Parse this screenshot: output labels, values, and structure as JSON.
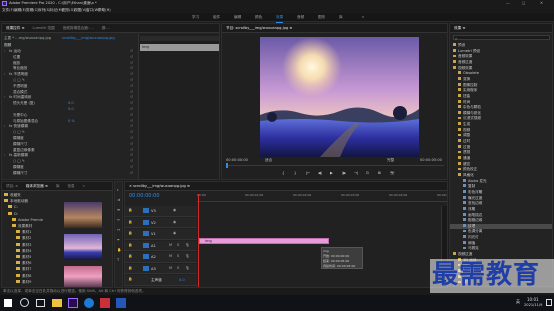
{
  "window": {
    "title": "Adobe Premiere Pro 2020 - C:\\用户\\Ethan\\桌面\\a *",
    "min_glyph": "—",
    "max_glyph": "□",
    "close_glyph": "✕"
  },
  "menubar": {
    "items": [
      "文件(F)",
      "编辑(E)",
      "剪辑(C)",
      "序列(S)",
      "标记(M)",
      "图形(G)",
      "视图(V)",
      "窗口(W)",
      "帮助(H)"
    ]
  },
  "workspaces": {
    "items": [
      "学习",
      "组件",
      "编辑",
      "颜色",
      "效果",
      "音频",
      "图形",
      "库"
    ],
    "active_index": 4,
    "more_glyph": "»"
  },
  "effect_controls": {
    "tabs": [
      "效果控件 ≡",
      "Lumetri 范围",
      "音频剪辑混合器: ...",
      "源:..."
    ],
    "active_tab": 0,
    "source_label": "主要 * ...mg/wuxuanpg.jpg",
    "clip_label": "scrollby___img/wuxuanpg.jpg",
    "video_header": "视频",
    "rows": [
      {
        "label": "fx 运动",
        "value": "",
        "indent": 0
      },
      {
        "label": "位置",
        "value": "",
        "indent": 1
      },
      {
        "label": "缩放",
        "value": "",
        "indent": 1
      },
      {
        "label": "等比缩放",
        "value": "",
        "indent": 1
      },
      {
        "label": "fx 不透明度",
        "value": "",
        "indent": 0
      },
      {
        "label": "○ □ ✎",
        "value": "",
        "indent": 1
      },
      {
        "label": "不透明度",
        "value": "",
        "indent": 1
      },
      {
        "label": "混合模式",
        "value": "",
        "indent": 1
      },
      {
        "label": "fx 时间重映射",
        "value": "",
        "indent": 0
      },
      {
        "label": "镜头光晕 (复)",
        "value": "0.0",
        "indent": 1
      },
      {
        "label": "",
        "value": "0.0",
        "indent": 1
      },
      {
        "label": "光晕中心",
        "value": "",
        "indent": 1
      },
      {
        "label": "与原始图像混合",
        "value": "0 %",
        "indent": 1
      },
      {
        "label": "fx 快速模糊",
        "value": "",
        "indent": 0
      },
      {
        "label": "○ □ ✎",
        "value": "",
        "indent": 1
      },
      {
        "label": "模糊度",
        "value": "",
        "indent": 1
      },
      {
        "label": "模糊尺寸",
        "value": "",
        "indent": 1
      },
      {
        "label": "重复边缘像素",
        "value": "",
        "indent": 1
      },
      {
        "label": "fx 高斯模糊",
        "value": "",
        "indent": 0
      },
      {
        "label": "○ □ ✎",
        "value": "",
        "indent": 1
      },
      {
        "label": "模糊度",
        "value": "",
        "indent": 1
      },
      {
        "label": "模糊尺寸",
        "value": "",
        "indent": 1
      }
    ],
    "mini_clip_label": "img"
  },
  "program_monitor": {
    "title": "节目: scrollby___img/wuxuanpg.jpg ≡",
    "tc_left": "00:00:00:00",
    "fit_label": "适合",
    "quality_label": "完整",
    "tc_right": "00:00:05:00",
    "buttons": [
      "{",
      "}",
      "|←",
      "◀|",
      "▶",
      "|▶",
      "→|",
      "⊡",
      "⊠",
      "📷"
    ]
  },
  "project_panel": {
    "tabs": [
      "项目: a",
      "媒体浏览器 ≡",
      "库",
      "信息",
      "»"
    ],
    "active_tab": 1,
    "tree": [
      {
        "label": "收藏夹",
        "indent": 0
      },
      {
        "label": "本地驱动器",
        "indent": 0
      },
      {
        "label": "C:",
        "indent": 1
      },
      {
        "label": "D:",
        "indent": 1
      },
      {
        "label": "Adobe Premie",
        "indent": 2
      },
      {
        "label": "效果素材",
        "indent": 2
      },
      {
        "label": "素材1",
        "indent": 3
      },
      {
        "label": "素材2",
        "indent": 3
      },
      {
        "label": "素材3",
        "indent": 3
      },
      {
        "label": "素材4",
        "indent": 3
      },
      {
        "label": "素材5",
        "indent": 3
      },
      {
        "label": "素材6",
        "indent": 3
      },
      {
        "label": "素材7",
        "indent": 3
      },
      {
        "label": "素材8",
        "indent": 3
      },
      {
        "label": "素材9",
        "indent": 3
      }
    ]
  },
  "timeline": {
    "tab": "× scrollby___img/wuxuanpg.jpg ≡",
    "timecode": "00:00:00:00",
    "ruler": [
      "00:00",
      "00:00:01:00",
      "00:00:02:00",
      "00:00:03:00",
      "00:00:04:00",
      "00:00:05:00"
    ],
    "tracks": [
      {
        "name": "V3",
        "type": "video"
      },
      {
        "name": "V2",
        "type": "video"
      },
      {
        "name": "V1",
        "type": "video"
      },
      {
        "name": "A1",
        "type": "audio"
      },
      {
        "name": "A2",
        "type": "audio"
      },
      {
        "name": "A3",
        "type": "audio"
      },
      {
        "name": "主声道",
        "type": "master"
      }
    ],
    "master_value": "0.0",
    "clip_label": "img",
    "tooltip": [
      "img",
      "开始: 00:00:00:00",
      "结束: 00:00:05:00",
      "持续时间: 00:00:05:00"
    ],
    "clip_progress": 0.44
  },
  "effects_panel": {
    "title": "效果 ≡",
    "search_placeholder": "",
    "items": [
      {
        "label": "预设",
        "indent": 0
      },
      {
        "label": "Lumetri 预设",
        "indent": 0
      },
      {
        "label": "音频效果",
        "indent": 0
      },
      {
        "label": "音频过渡",
        "indent": 0
      },
      {
        "label": "视频效果",
        "indent": 0
      },
      {
        "label": "Obsolete",
        "indent": 1
      },
      {
        "label": "变换",
        "indent": 1
      },
      {
        "label": "图像控制",
        "indent": 1
      },
      {
        "label": "实用程序",
        "indent": 1
      },
      {
        "label": "扭曲",
        "indent": 1
      },
      {
        "label": "时间",
        "indent": 1
      },
      {
        "label": "杂色与颗粒",
        "indent": 1
      },
      {
        "label": "模糊与锐化",
        "indent": 1
      },
      {
        "label": "沉浸式视频",
        "indent": 1
      },
      {
        "label": "生成",
        "indent": 1
      },
      {
        "label": "视频",
        "indent": 1
      },
      {
        "label": "调整",
        "indent": 1
      },
      {
        "label": "过时",
        "indent": 1
      },
      {
        "label": "过渡",
        "indent": 1
      },
      {
        "label": "透视",
        "indent": 1
      },
      {
        "label": "通道",
        "indent": 1
      },
      {
        "label": "键控",
        "indent": 1
      },
      {
        "label": "颜色校正",
        "indent": 1
      },
      {
        "label": "风格化",
        "indent": 1
      },
      {
        "label": "Alpha 发光",
        "indent": 2
      },
      {
        "label": "复制",
        "indent": 2
      },
      {
        "label": "彩色浮雕",
        "indent": 2
      },
      {
        "label": "曝光过度",
        "indent": 2
      },
      {
        "label": "查找边缘",
        "indent": 2
      },
      {
        "label": "浮雕",
        "indent": 2
      },
      {
        "label": "画笔描边",
        "indent": 2
      },
      {
        "label": "粗糙边缘",
        "indent": 2
      },
      {
        "label": "纹理",
        "indent": 2
      },
      {
        "label": "色调分离",
        "indent": 2
      },
      {
        "label": "闪光灯",
        "indent": 2
      },
      {
        "label": "阈值",
        "indent": 2
      },
      {
        "label": "马赛克",
        "indent": 2
      },
      {
        "label": "视频过渡",
        "indent": 0
      },
      {
        "label": "3D 运动",
        "indent": 1
      },
      {
        "label": "Iris",
        "indent": 1
      },
      {
        "label": "内滑",
        "indent": 1
      },
      {
        "label": "划像",
        "indent": 1
      },
      {
        "label": "擦除",
        "indent": 1
      }
    ],
    "selected_index": 32
  },
  "statusbar": {
    "text": "单击以选择，或单击空白处并拖动以进行框选。使用 Shift、Alt 和 Ctrl 可获得其他选项。"
  },
  "taskbar": {
    "time": "10:01",
    "date": "2021/11/9",
    "lang": "英"
  },
  "watermark": {
    "text": "最需教育"
  },
  "colors": {
    "accent_blue": "#2d8ceb",
    "clip_pink": "#e79bd8",
    "playhead_red": "#d12a2a",
    "selected_row": "#4a4a4a"
  }
}
